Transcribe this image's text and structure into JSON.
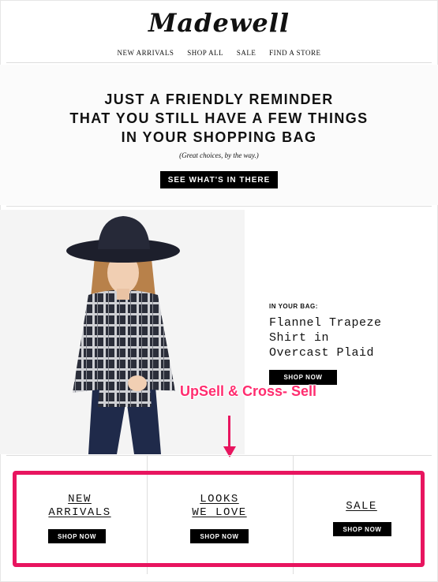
{
  "brand": {
    "logo_text": "Madewell"
  },
  "nav": {
    "items": [
      "NEW ARRIVALS",
      "SHOP ALL",
      "SALE",
      "FIND A STORE"
    ]
  },
  "hero": {
    "headline_lines": [
      "JUST A FRIENDLY REMINDER",
      "THAT YOU STILL HAVE A FEW THINGS",
      "IN YOUR SHOPPING BAG"
    ],
    "subtext": "(Great choices, by the way.)",
    "cta_label": "SEE WHAT'S IN THERE"
  },
  "product": {
    "bag_label": "IN YOUR BAG:",
    "name_lines": [
      "Flannel Trapeze",
      "Shirt in",
      "Overcast Plaid"
    ],
    "shop_label": "SHOP NOW"
  },
  "annotation": {
    "label": "UpSell & Cross- Sell",
    "color": "#e8155f"
  },
  "categories": [
    {
      "title_lines": [
        "NEW",
        "ARRIVALS"
      ],
      "shop_label": "SHOP NOW"
    },
    {
      "title_lines": [
        "LOOKS",
        "WE LOVE"
      ],
      "shop_label": "SHOP NOW"
    },
    {
      "title_lines": [
        "SALE"
      ],
      "shop_label": "SHOP NOW"
    }
  ]
}
